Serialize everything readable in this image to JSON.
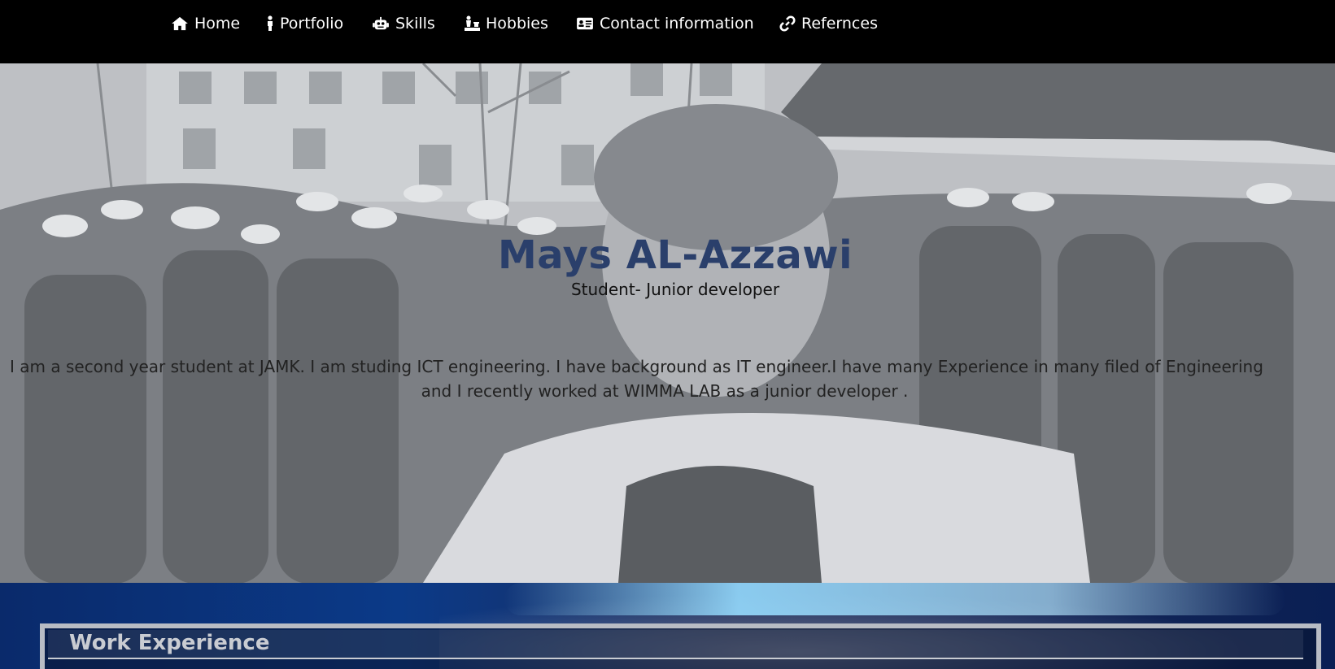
{
  "nav": {
    "items": [
      {
        "label": "Home",
        "icon": "home-icon"
      },
      {
        "label": "Portfolio",
        "icon": "person-icon"
      },
      {
        "label": "Skills",
        "icon": "robot-icon"
      },
      {
        "label": "Hobbies",
        "icon": "chess-icon"
      },
      {
        "label": "Contact information",
        "icon": "id-card-icon"
      },
      {
        "label": "Refernces",
        "icon": "link-icon"
      }
    ]
  },
  "hero": {
    "name": "Mays AL-Azzawi",
    "role": "Student- Junior developer",
    "bio_line1": "I am a second year student at JAMK. I am studing ICT engineering. I have background as IT engineer.I have many Experience in many filed of Engineering",
    "bio_line2": "and I recently worked at WIMMA LAB as a junior developer ."
  },
  "work": {
    "title": "Work Experience"
  },
  "colors": {
    "nav_bg": "#000000",
    "name_color": "#2a3f6b",
    "section_blue": "#0b3a88"
  }
}
